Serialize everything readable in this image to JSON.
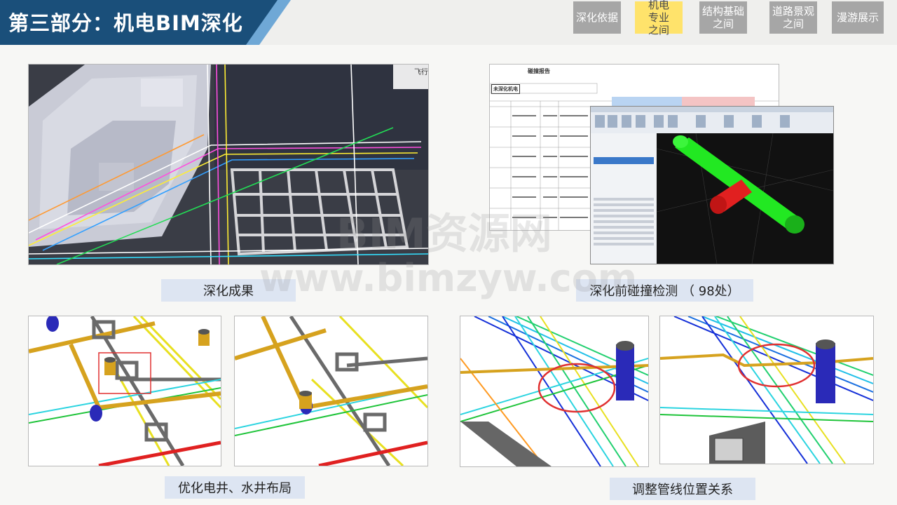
{
  "header": {
    "title": "第三部分：机电BIM深化",
    "tabs": [
      {
        "label": "深化依据",
        "active": false
      },
      {
        "label": "机电专业之间",
        "active": true
      },
      {
        "label": "结构基础之间",
        "active": false
      },
      {
        "label": "道路景观之间",
        "active": false
      },
      {
        "label": "漫游展示",
        "active": false
      }
    ]
  },
  "captions": {
    "result": "深化成果",
    "clash": "深化前碰撞检测 （ 98处）",
    "shaft": "优化电井、水井布局",
    "pipes": "调整管线位置关系"
  },
  "report": {
    "title": "碰撞报告",
    "row_label": "未深化机电",
    "partial_label": "飞行"
  },
  "watermark": {
    "line1": "BIM资源网",
    "line2": "www.bimzyw.com"
  },
  "colors": {
    "title_bg": "#1a4f7a",
    "title_accent": "#6fa8d6",
    "active_tab": "#ffe36b",
    "tab": "#a6a6a6",
    "caption_bg": "#dde5f2",
    "clash_red": "#e03030",
    "pipe_gold": "#d6a21e",
    "pipe_green": "#22e822"
  }
}
